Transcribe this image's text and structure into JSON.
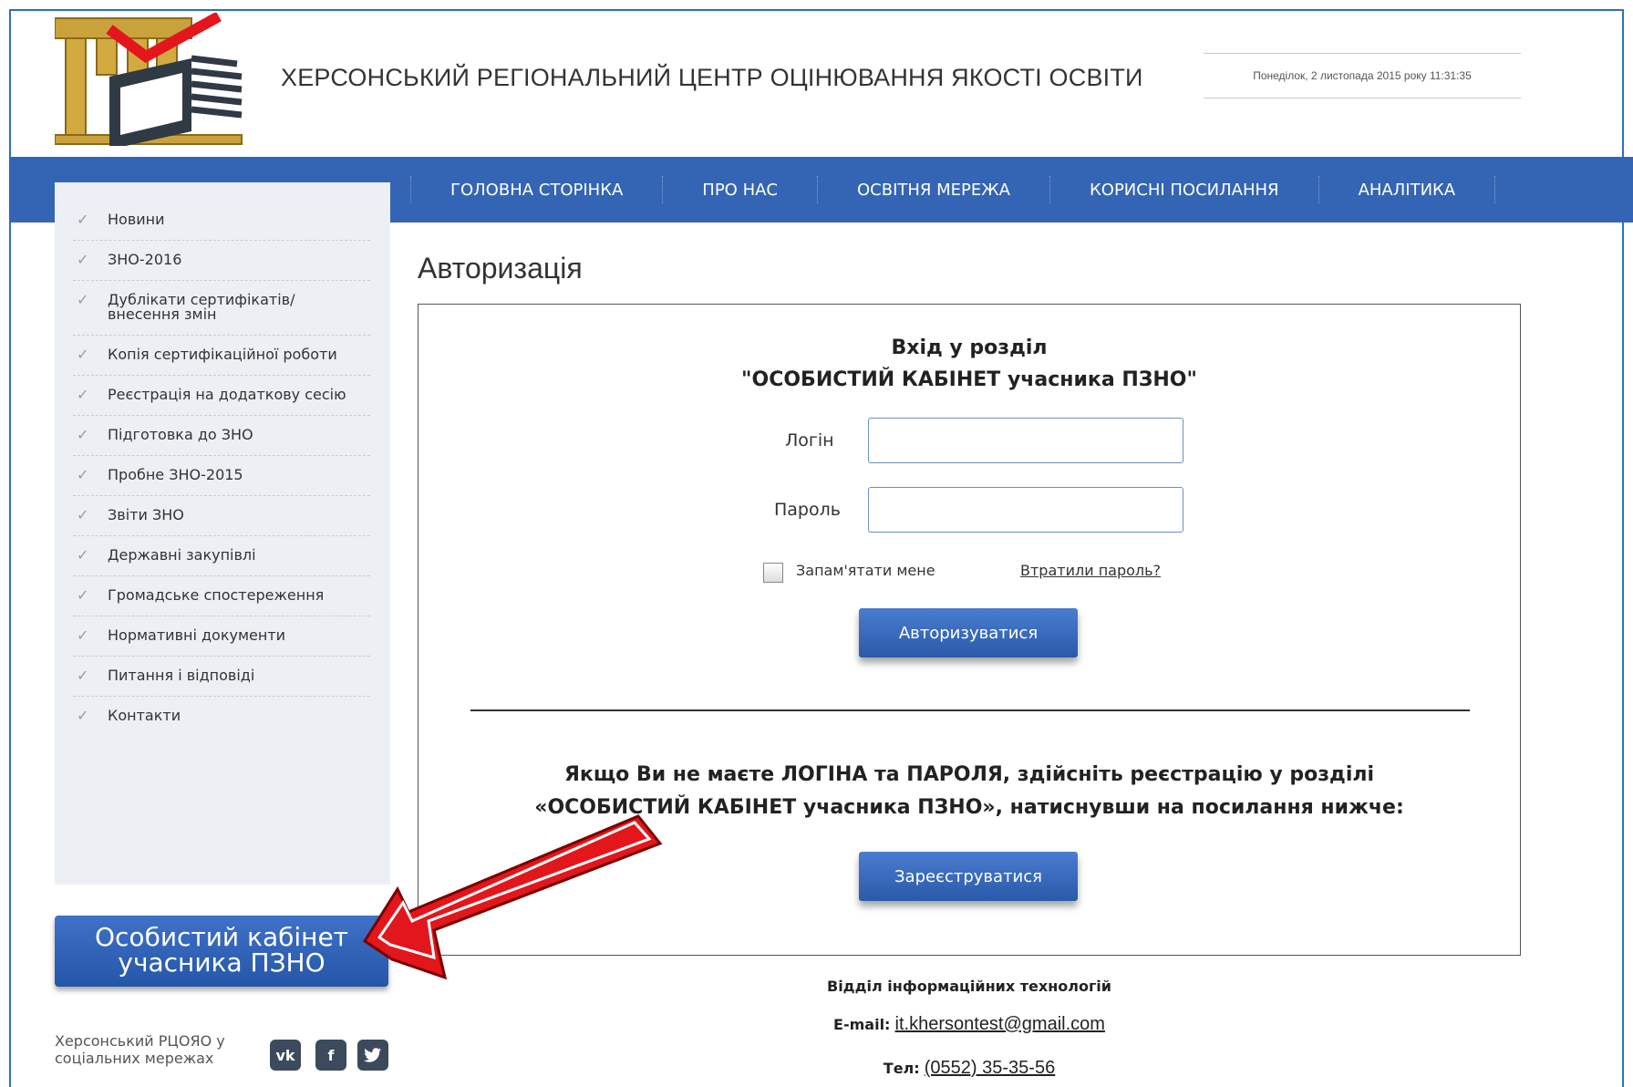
{
  "header": {
    "site_title": "ХЕРСОНСЬКИЙ РЕГІОНАЛЬНИЙ ЦЕНТР ОЦІНЮВАННЯ ЯКОСТІ ОСВІТИ",
    "datetime": "Понеділок, 2 листопада 2015 року 11:31:35"
  },
  "nav": {
    "items": [
      "ГОЛОВНА СТОРІНКА",
      "ПРО НАС",
      "ОСВІТНЯ МЕРЕЖА",
      "КОРИСНІ ПОСИЛАННЯ",
      "АНАЛІТИКА"
    ]
  },
  "sidebar": {
    "items": [
      "Новини",
      "ЗНО-2016",
      "Дублікати сертифікатів/ внесення змін",
      "Копія сертифікаційної роботи",
      "Реєстрація на додаткову сесію",
      "Підготовка до ЗНО",
      "Пробне ЗНО-2015",
      "Звіти ЗНО",
      "Державні закупівлі",
      "Громадське спостереження",
      "Нормативні документи",
      "Питання і відповіді",
      "Контакти"
    ],
    "cabinet_button_line1": "Особистий кабінет",
    "cabinet_button_line2": "учасника ПЗНО",
    "social_text": "Херсонський РЦОЯО у соціальних мережах",
    "social_icons": [
      "vk-icon",
      "facebook-icon",
      "twitter-icon"
    ]
  },
  "main": {
    "title": "Авторизація",
    "enter_line1": "Вхід у розділ",
    "enter_line2": "\"ОСОБИСТИЙ КАБІНЕТ учасника ПЗНО\"",
    "login_label": "Логін",
    "login_value": "",
    "password_label": "Пароль",
    "password_value": "",
    "remember_label": "Запам'ятати мене",
    "lost_password": "Втратили пароль?",
    "login_button": "Авторизуватися",
    "register_line1": "Якщо Ви не маєте ЛОГІНА та ПАРОЛЯ, здійсніть реєстрацію у розділі",
    "register_line2": "«ОСОБИСТИЙ КАБІНЕТ учасника ПЗНО», натиснувши на посилання нижче:",
    "register_button": "Зареєструватися"
  },
  "footer": {
    "department": "Відділ інформаційних технологій",
    "email_label": "E-mail:",
    "email": "it.khersontest@gmail.com",
    "phone_label": "Тел:",
    "phone": "(0552) 35-35-56"
  },
  "colors": {
    "nav_bg": "#3465b4",
    "button_blue": "#2a5aa8",
    "arrow_red": "#e3161b",
    "frame_border": "#2f6fb6"
  }
}
